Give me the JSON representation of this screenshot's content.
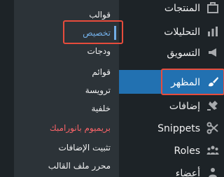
{
  "submenu": {
    "items": [
      {
        "label": "قوالب"
      },
      {
        "label": "تخصيص"
      },
      {
        "label": "ودجات"
      },
      {
        "label": "قوائم"
      },
      {
        "label": "ترويسة"
      },
      {
        "label": "خلفية"
      },
      {
        "label": "بريميوم بانورامبك"
      },
      {
        "label": "تثبيت الإضافات"
      },
      {
        "label": "محرر ملف القالب"
      }
    ]
  },
  "mainmenu": {
    "items": [
      {
        "label": "المنتجات",
        "icon": "products-icon"
      },
      {
        "label": "التحليلات",
        "icon": "analytics-icon"
      },
      {
        "label": "التسويق",
        "icon": "marketing-icon"
      },
      {
        "label": "المظهر",
        "icon": "brush-icon"
      },
      {
        "label": "إضافات",
        "icon": "plugin-icon"
      },
      {
        "label": "Snippets",
        "icon": "scissors-icon"
      },
      {
        "label": "Roles",
        "icon": "users-icon"
      },
      {
        "label": "أعضاء",
        "icon": "user-icon"
      }
    ]
  },
  "colors": {
    "sidebar_bg": "#1d2327",
    "submenu_bg": "#2c3338",
    "accent": "#2271b1",
    "current_text": "#72aee6",
    "promo_text": "#f86368",
    "highlight": "#e74c3c"
  }
}
